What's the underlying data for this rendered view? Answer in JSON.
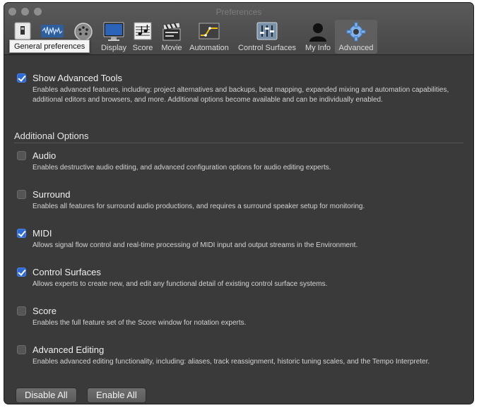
{
  "window": {
    "title": "Preferences"
  },
  "toolbar": {
    "tooltip": "General preferences",
    "tabs": [
      {
        "icon": "general-icon",
        "label": ""
      },
      {
        "icon": "audio-icon",
        "label": ""
      },
      {
        "icon": "midi-icon",
        "label": ""
      },
      {
        "icon": "display-icon",
        "label": "Display"
      },
      {
        "icon": "score-icon",
        "label": "Score"
      },
      {
        "icon": "movie-icon",
        "label": "Movie"
      },
      {
        "icon": "automation-icon",
        "label": "Automation"
      },
      {
        "icon": "control-surfaces-icon",
        "label": "Control Surfaces"
      },
      {
        "icon": "my-info-icon",
        "label": "My Info"
      },
      {
        "icon": "advanced-icon",
        "label": "Advanced"
      }
    ],
    "selected_tab": "Advanced"
  },
  "main": {
    "show_advanced": {
      "title": "Show Advanced Tools",
      "checked": true,
      "description": "Enables advanced features, including: project alternatives and backups, beat mapping, expanded mixing and automation capabilities, additional editors and browsers, and more. Additional options become available and can be individually enabled."
    },
    "section_title": "Additional Options",
    "options": [
      {
        "title": "Audio",
        "checked": false,
        "description": "Enables destructive audio editing, and advanced configuration options for audio editing experts."
      },
      {
        "title": "Surround",
        "checked": false,
        "description": "Enables all features for surround audio productions, and requires a surround speaker setup for monitoring."
      },
      {
        "title": "MIDI",
        "checked": true,
        "description": "Allows signal flow control and real-time processing of MIDI input and output streams in the Environment."
      },
      {
        "title": "Control Surfaces",
        "checked": true,
        "description": "Allows experts to create new, and edit any functional detail of existing control surface systems."
      },
      {
        "title": "Score",
        "checked": false,
        "description": "Enables the full feature set of the Score window for notation experts."
      },
      {
        "title": "Advanced Editing",
        "checked": false,
        "description": "Enables advanced editing functionality, including: aliases, track reassignment, historic tuning scales, and the Tempo Interpreter."
      }
    ],
    "buttons": {
      "disable_all": "Disable All",
      "enable_all": "Enable All"
    }
  },
  "colors": {
    "accent": "#2d6ad8",
    "background": "#3a3a3a",
    "toolbar": "#4f4f4f"
  }
}
